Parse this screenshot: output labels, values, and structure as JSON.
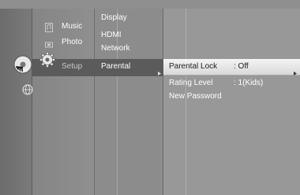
{
  "main_menu": {
    "music_label": "Music",
    "photo_label": "Photo",
    "setup_label": "Setup"
  },
  "sub_menu": {
    "display_label": "Display",
    "hdmi_label": "HDMI",
    "network_label": "Network",
    "parental_label": "Parental"
  },
  "settings": {
    "parental_lock": {
      "label": "Parental Lock",
      "value": ": Off"
    },
    "rating_level": {
      "label": "Rating Level",
      "value": ": 1(Kids)"
    },
    "new_password": {
      "label": "New Password"
    }
  },
  "icons": {
    "disc": "disc-icon",
    "globe": "globe-icon",
    "music": "music-icon",
    "photo": "photo-icon",
    "setup": "gear-icon",
    "arrow": "arrow-right-icon"
  },
  "colors": {
    "highlight_bar": "#5b5b5b",
    "selected_row": "#e6e6e6"
  }
}
